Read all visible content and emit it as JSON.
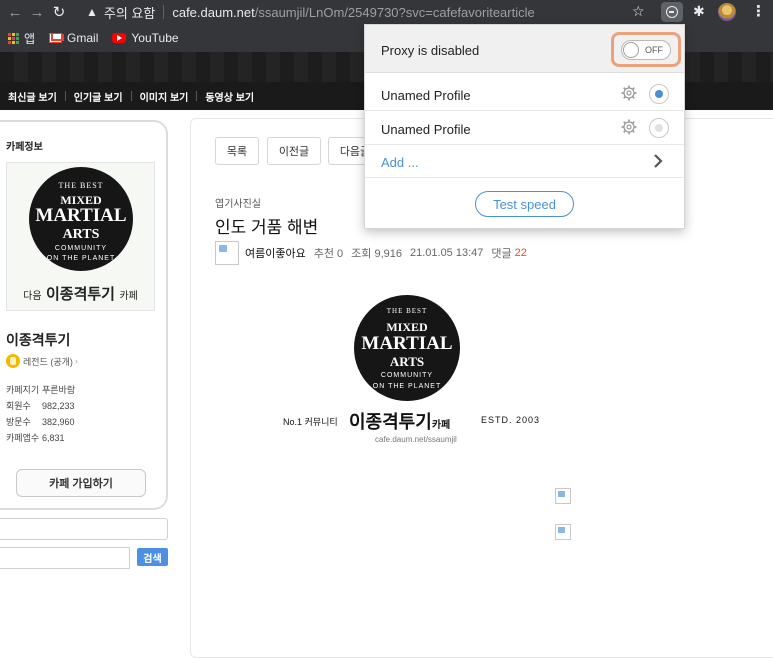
{
  "browser": {
    "security_label": "주의 요함",
    "url_host": "cafe.daum.net",
    "url_path": "/ssaumjil/LnOm/2549730?svc=cafefavoritearticle",
    "bookmarks": [
      "앱",
      "Gmail",
      "YouTube"
    ]
  },
  "cafe_nav": [
    "최신글 보기",
    "인기글 보기",
    "이미지 보기",
    "동영상 보기"
  ],
  "sidebar": {
    "title": "카페정보",
    "logo": {
      "top": "THE BEST",
      "line1": "MIXED",
      "line2": "MARTIAL",
      "line3": "ARTS",
      "sub": "COMMUNITY",
      "bottom": "ON THE PLANET",
      "caption_small": "다음",
      "caption_big": "이종격투기",
      "caption_suffix": "카페"
    },
    "cafe_name": "이종격투기",
    "level": "레전드 (공개)",
    "stats": [
      {
        "label": "카페지기",
        "value": "푸른바람"
      },
      {
        "label": "회원수",
        "value": "982,233"
      },
      {
        "label": "방문수",
        "value": "382,960"
      },
      {
        "label": "카페앱수",
        "value": "6,831"
      }
    ],
    "join_button": "카페 가입하기",
    "search_button": "검색"
  },
  "post": {
    "buttons": [
      "목록",
      "이전글",
      "다음글"
    ],
    "board": "엽기사진실",
    "title": "인도 거품 해변",
    "author": "여름이좋아요",
    "recommend": "추천 0",
    "views": "조회 9,916",
    "date": "21.01.05 13:47",
    "replies_label": "댓글",
    "replies_count": "22",
    "image_logo": {
      "top": "THE BEST",
      "line1": "MIXED",
      "line2": "MARTIAL",
      "line3": "ARTS",
      "sub": "COMMUNITY",
      "bottom": "ON THE PLANET"
    },
    "tagline_left": "No.1 커뮤니티",
    "tagline_center": "이종격투기",
    "tagline_cafe": "카페",
    "tagline_right": "ESTD. 2003",
    "tagline_url": "cafe.daum.net/ssaumjil"
  },
  "proxy_popup": {
    "status": "Proxy is disabled",
    "toggle_label": "OFF",
    "profiles": [
      {
        "name": "Unamed Profile",
        "selected": true
      },
      {
        "name": "Unamed Profile",
        "selected": false
      }
    ],
    "add_label": "Add ...",
    "test_button": "Test speed"
  },
  "colors": {
    "accent_blue": "#4a90d9",
    "toggle_highlight": "#eba17a",
    "chrome_dark": "#35363a",
    "reply_red": "#e8503a",
    "search_blue": "#4e8fe6"
  }
}
